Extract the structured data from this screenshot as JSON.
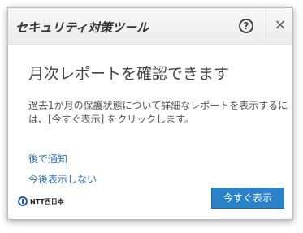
{
  "window": {
    "title": "セキュリティ対策ツール",
    "help_icon": "help-icon",
    "help_glyph": "?",
    "close_icon": "close-icon",
    "close_glyph": "×"
  },
  "main": {
    "heading": "月次レポートを確認できます",
    "description": "過去1か月の保護状態について詳細なレポートを表示するには、[今すぐ表示] をクリックします。",
    "link_later": "後で通知",
    "link_never": "今後表示しない"
  },
  "footer": {
    "logo_text": "NTT西日本",
    "primary_button": "今すぐ表示"
  },
  "colors": {
    "accent": "#2a82c8",
    "link": "#2a73b8"
  }
}
